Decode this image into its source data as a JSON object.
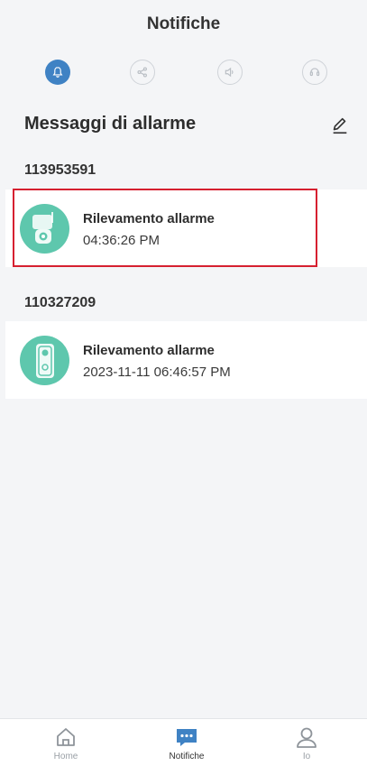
{
  "header": {
    "title": "Notifiche"
  },
  "filters": [
    {
      "icon": "bell-icon",
      "active": true
    },
    {
      "icon": "share-icon",
      "active": false
    },
    {
      "icon": "speaker-icon",
      "active": false
    },
    {
      "icon": "support-icon",
      "active": false
    }
  ],
  "section": {
    "title": "Messaggi di allarme",
    "edit_icon": "edit-icon"
  },
  "groups": [
    {
      "device_id": "113953591",
      "message": {
        "title": "Rilevamento allarme",
        "time": "04:36:26 PM",
        "device_icon": "ptz-camera-icon"
      }
    },
    {
      "device_id": "110327209",
      "message": {
        "title": "Rilevamento allarme",
        "time": "2023-11-11 06:46:57 PM",
        "device_icon": "doorbell-icon"
      }
    }
  ],
  "tabbar": {
    "items": [
      {
        "label": "Home",
        "icon": "home-icon",
        "active": false
      },
      {
        "label": "Notifiche",
        "icon": "chat-icon",
        "active": true
      },
      {
        "label": "Io",
        "icon": "user-icon",
        "active": false
      }
    ]
  },
  "colors": {
    "accent": "#3f82c4",
    "avatar": "#5ec7ad",
    "highlight": "#d62030"
  }
}
